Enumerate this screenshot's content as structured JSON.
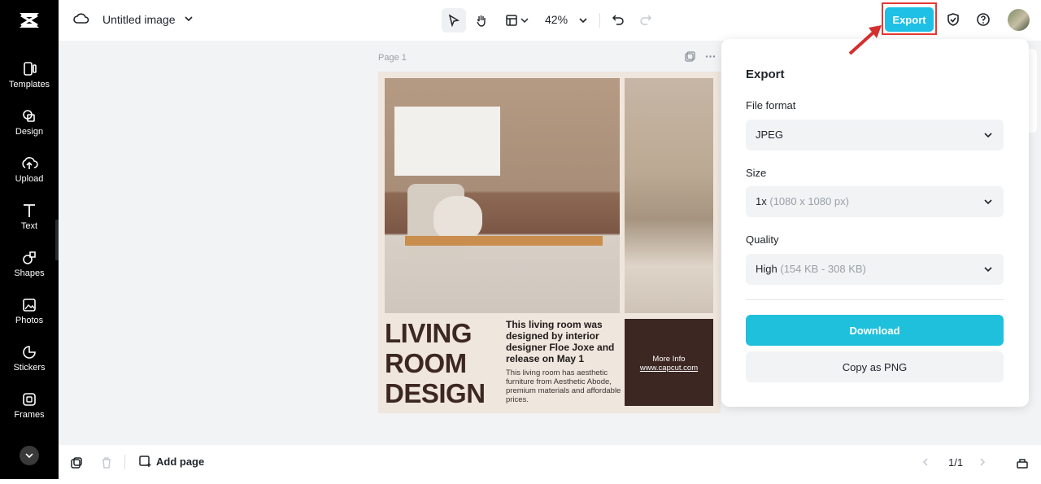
{
  "sidebar": {
    "items": [
      {
        "label": "Templates",
        "icon": "templates-icon"
      },
      {
        "label": "Design",
        "icon": "design-icon"
      },
      {
        "label": "Upload",
        "icon": "upload-icon"
      },
      {
        "label": "Text",
        "icon": "text-icon"
      },
      {
        "label": "Shapes",
        "icon": "shapes-icon"
      },
      {
        "label": "Photos",
        "icon": "photos-icon"
      },
      {
        "label": "Stickers",
        "icon": "stickers-icon"
      },
      {
        "label": "Frames",
        "icon": "frames-icon"
      }
    ]
  },
  "header": {
    "title": "Untitled image",
    "zoom": "42%",
    "export_label": "Export"
  },
  "canvas": {
    "page_label": "Page 1",
    "design": {
      "headline": "LIVING ROOM DESIGN",
      "headline_lines": [
        "LIVING",
        "ROOM",
        "DESIGN"
      ],
      "subhead": "This living room was designed by interior designer Floe Joxe and release on May 1",
      "body": "This living room has aesthetic furniture from Aesthetic Abode, premium materials and affordable prices.",
      "info_label": "More Info",
      "info_url": "www.capcut.com"
    }
  },
  "export_panel": {
    "title": "Export",
    "file_format": {
      "label": "File format",
      "value": "JPEG"
    },
    "size": {
      "label": "Size",
      "value": "1x",
      "detail": "(1080 x 1080 px)"
    },
    "quality": {
      "label": "Quality",
      "value": "High",
      "detail": "(154 KB - 308 KB)"
    },
    "download_label": "Download",
    "copy_label": "Copy as PNG"
  },
  "footer": {
    "add_page_label": "Add page",
    "page_indicator": "1/1"
  },
  "colors": {
    "accent": "#1fc0e6",
    "rail_bg": "#000000",
    "workspace_bg": "#f1f3f5",
    "design_brown": "#3c2722",
    "highlight_red": "#e53935"
  }
}
